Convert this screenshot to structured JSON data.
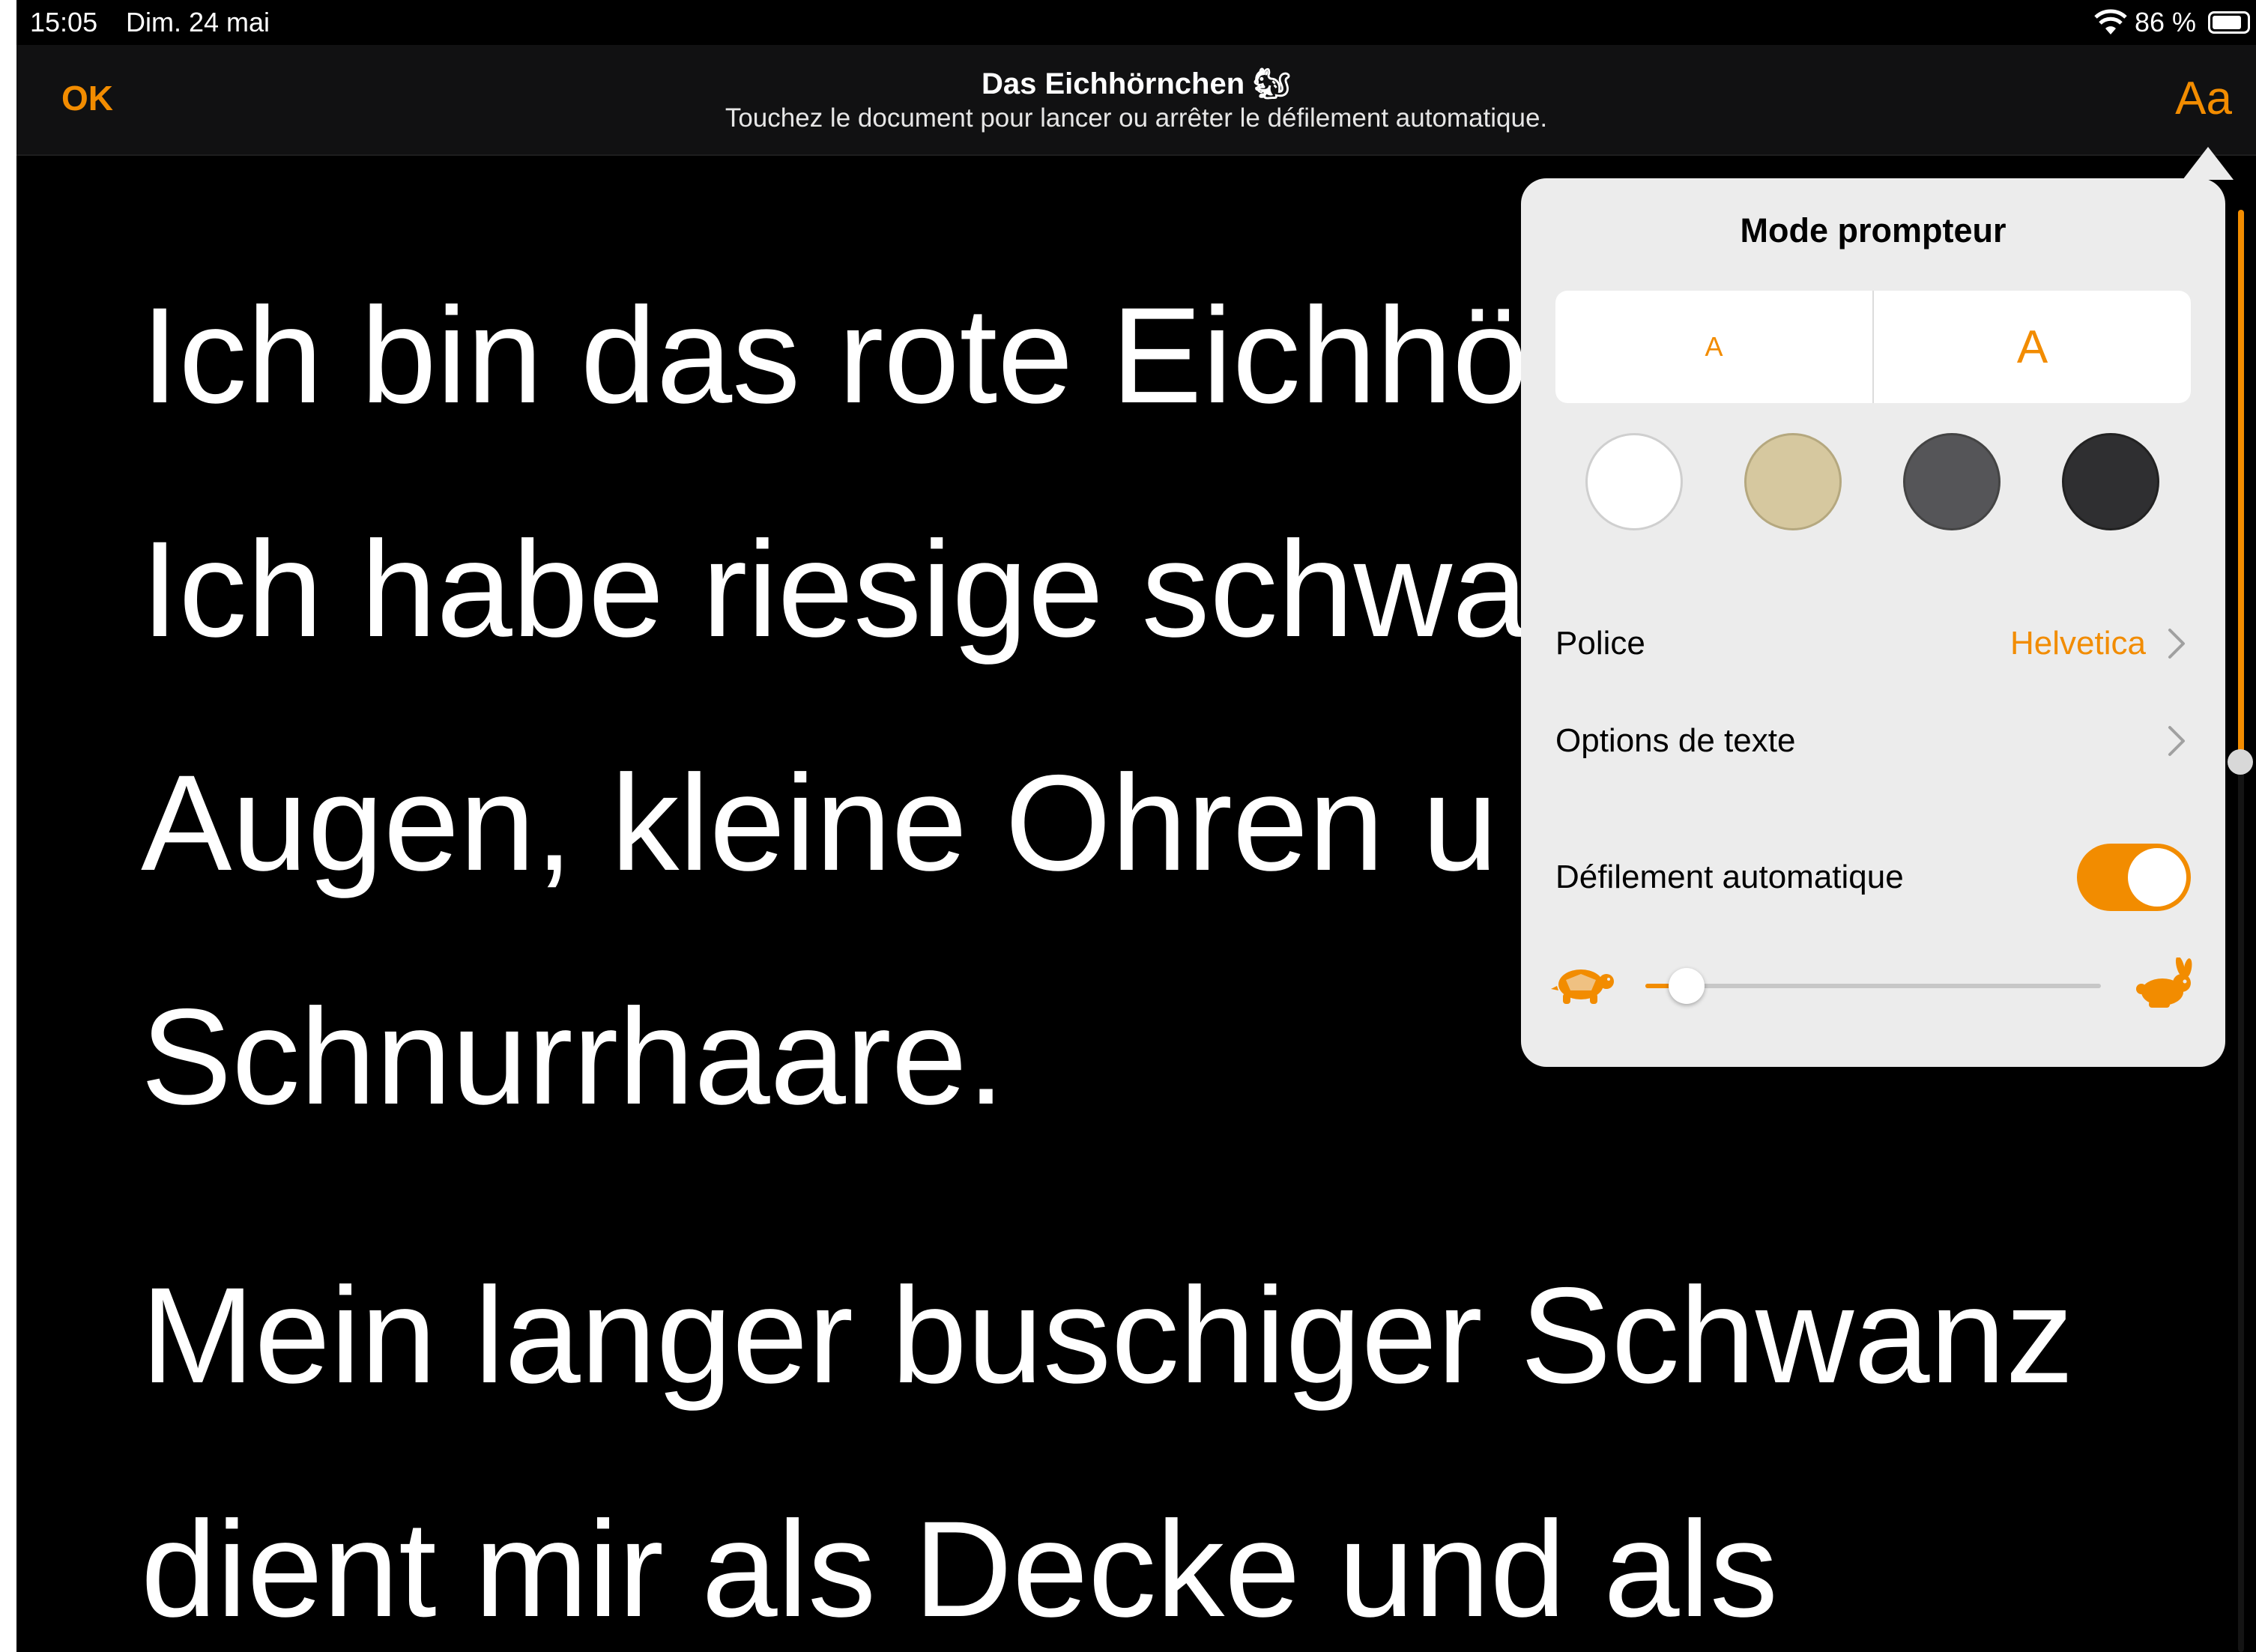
{
  "status_bar": {
    "time": "15:05",
    "date": "Dim. 24 mai",
    "battery_text": "86 %",
    "battery_level": 0.86
  },
  "nav": {
    "ok_label": "OK",
    "title": "Das Eichhörnchen 🐿",
    "subtitle": "Touchez le document pour lancer ou arrêter le défilement automatique.",
    "format_button": "Aa"
  },
  "reader": {
    "lines_para1": [
      "Ich bin das rote Eichhö",
      "Ich habe riesige schwa",
      "Augen, kleine Ohren u",
      "Schnurrhaare."
    ],
    "lines_para2": [
      "Mein langer buschiger Schwanz",
      "dient mir als Decke und als"
    ]
  },
  "popover": {
    "title": "Mode prompteur",
    "size_small": "A",
    "size_large": "A",
    "swatches": [
      "white",
      "sepia",
      "gray",
      "dark"
    ],
    "font_label": "Police",
    "font_value": "Helvetica",
    "text_options_label": "Options de texte",
    "autoscroll_label": "Défilement automatique",
    "autoscroll_on": true,
    "speed_value": 0.09
  },
  "colors": {
    "accent": "#F28C00",
    "background": "#000000",
    "popover": "#ECECEC"
  },
  "icons": [
    "wifi-icon",
    "battery-icon",
    "chevron-right-icon",
    "turtle-icon",
    "rabbit-icon"
  ]
}
